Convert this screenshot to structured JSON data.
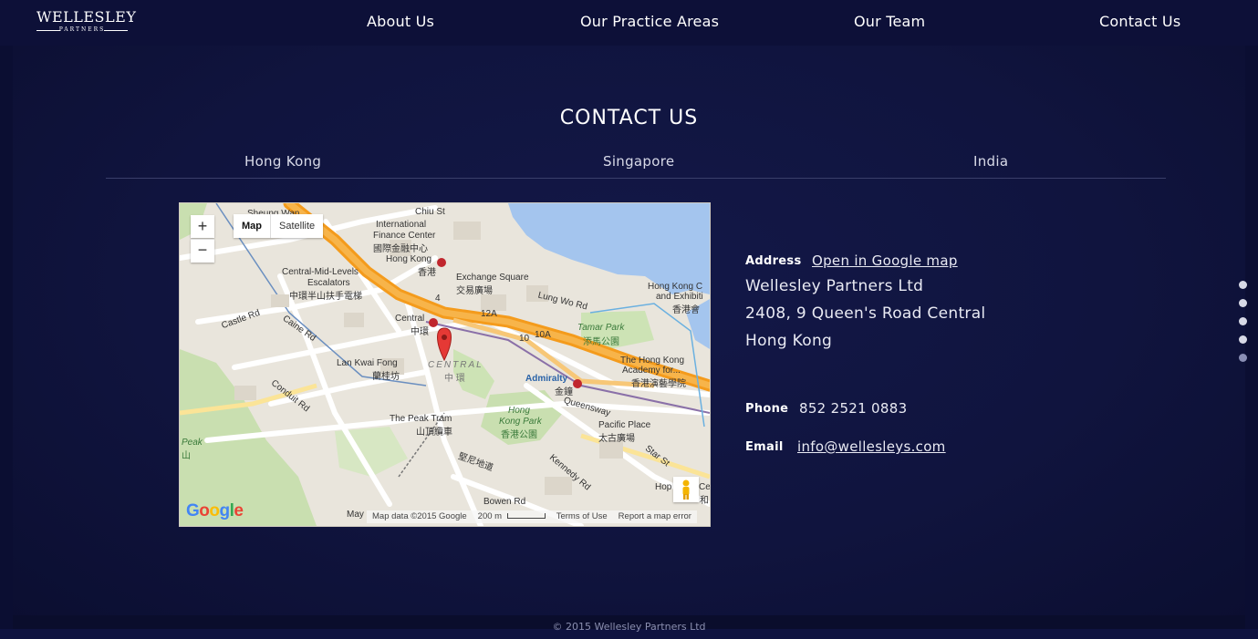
{
  "brand": {
    "logo_main": "WELLESLEY",
    "logo_sub": "PARTNERS"
  },
  "nav": {
    "items": [
      {
        "label": "About Us"
      },
      {
        "label": "Our Practice Areas"
      },
      {
        "label": "Our Team"
      },
      {
        "label": "Contact Us"
      }
    ]
  },
  "section": {
    "title": "CONTACT US"
  },
  "tabs": [
    {
      "label": "Hong Kong"
    },
    {
      "label": "Singapore"
    },
    {
      "label": "India"
    }
  ],
  "map": {
    "type_options": [
      "Map",
      "Satellite"
    ],
    "zoom_in": "+",
    "zoom_out": "−",
    "google_logo": "Google",
    "footer": {
      "data": "Map data ©2015 Google",
      "scale": "200 m",
      "terms": "Terms of Use",
      "report": "Report a map error"
    },
    "labels": {
      "sheung_wan": "Sheung Wan",
      "ifc": "International",
      "ifc2": "Finance Center",
      "ifc_zh": "國際金融中心",
      "hk": "Hong Kong",
      "hk_zh": "香港",
      "exchange": "Exchange Square",
      "exchange_zh": "交易廣場",
      "midlevels": "Central-Mid-Levels",
      "escalators": "Escalators",
      "escalators_zh": "中環半山扶手電梯",
      "lungwo": "Lung Wo Rd",
      "hkc": "Hong Kong C",
      "hkc2": "and Exhibiti",
      "hkc_zh": "香港會",
      "central": "Central",
      "central_zh": "中環",
      "tamar": "Tamar Park",
      "tamar_zh": "添馬公園",
      "castle": "Castle Rd",
      "caine": "Caine Rd",
      "lkf": "Lan Kwai Fong",
      "lkf_zh": "蘭桂坊",
      "central_big": "CENTRAL",
      "central_big_zh": "中 環",
      "admiralty": "Admiralty",
      "admiralty_zh": "金鐘",
      "hkapa": "The Hong Kong",
      "hkapa2": "Academy for...",
      "hkapa_zh": "香港演藝學院",
      "conduit": "Conduit Rd",
      "queensway": "Queensway",
      "peaktram": "The Peak Tram",
      "peaktram_zh": "山頂纜車",
      "hkpark": "Hong",
      "hkpark2": "Kong Park",
      "hkpark_zh": "香港公園",
      "pacific": "Pacific Place",
      "pacific_zh": "太古廣場",
      "peak": "Peak",
      "peak_zh": "山",
      "kennedy": "Kennedy Rd",
      "startst": "Star St",
      "cotton": "堅尼地道",
      "bowen": "Bowen Rd",
      "hop": "Hop",
      "ce": "Ce",
      "ce_zh": "和",
      "chiu": "Chiu St",
      "may": "May",
      "r12a": "12A",
      "r10": "10",
      "r10a": "10A",
      "r4": "4"
    }
  },
  "contact": {
    "address_label": "Address",
    "map_link": "Open in Google map",
    "address_lines": [
      "Wellesley Partners Ltd",
      "2408, 9 Queen's Road Central",
      "Hong Kong"
    ],
    "phone_label": "Phone",
    "phone": "852 2521 0883",
    "email_label": "Email",
    "email": "info@wellesleys.com"
  },
  "footer": {
    "copyright": "© 2015 Wellesley Partners Ltd"
  },
  "colors": {
    "background": "#0f1340",
    "nav": "#0d1038",
    "text": "#ffffff"
  }
}
